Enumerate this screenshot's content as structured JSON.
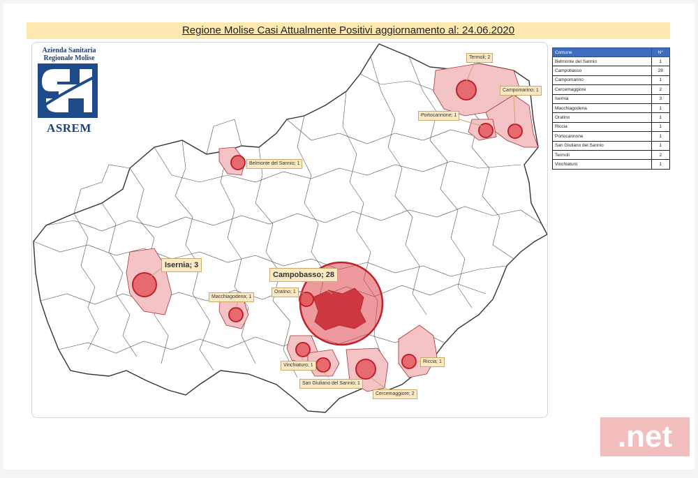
{
  "title": "Regione Molise Casi Attualmente Positivi aggiornamento al: 24.06.2020",
  "logo": {
    "line1": "Azienda Sanitaria",
    "line2": "Regionale Molise",
    "name": "ASREM"
  },
  "table": {
    "header": {
      "comune": "Comune",
      "count": "N°"
    },
    "rows": [
      {
        "comune": "Belmonte del Sannio",
        "count": "1"
      },
      {
        "comune": "Campobasso",
        "count": "28"
      },
      {
        "comune": "Campomarino",
        "count": "1"
      },
      {
        "comune": "Cercemaggiore",
        "count": "2"
      },
      {
        "comune": "Isernia",
        "count": "3"
      },
      {
        "comune": "Macchiagodena",
        "count": "1"
      },
      {
        "comune": "Oratino",
        "count": "1"
      },
      {
        "comune": "Riccia",
        "count": "1"
      },
      {
        "comune": "Portocannone",
        "count": "1"
      },
      {
        "comune": "San Giuliano del Sannio",
        "count": "1"
      },
      {
        "comune": "Termoli",
        "count": "2"
      },
      {
        "comune": "Vinchiaturo",
        "count": "1"
      }
    ]
  },
  "callouts": {
    "termoli": "Termoli; 2",
    "campomarino": "Campomarino; 1",
    "portocannone": "Portocannone; 1",
    "belmonte": "Belmonte del Sannio; 1",
    "isernia": "Isernia; 3",
    "campobasso": "Campobasso; 28",
    "oratino": "Oratino; 1",
    "macchiagodena": "Macchiagodena; 1",
    "vinchiaturo": "Vinchiaturo; 1",
    "san_giuliano": "San Giuliano del Sannio; 1",
    "cercemaggiore": "Cercemaggiore; 2",
    "riccia": "Riccia; 1"
  },
  "colors": {
    "bubble_fill": "#e0454c",
    "bubble_stroke": "#c0202a",
    "highlight_area": "#f3c3c6",
    "capital_area": "#b8262f",
    "title_band": "#fde9b0",
    "table_header": "#3e6cc0"
  },
  "watermark": ".net"
}
